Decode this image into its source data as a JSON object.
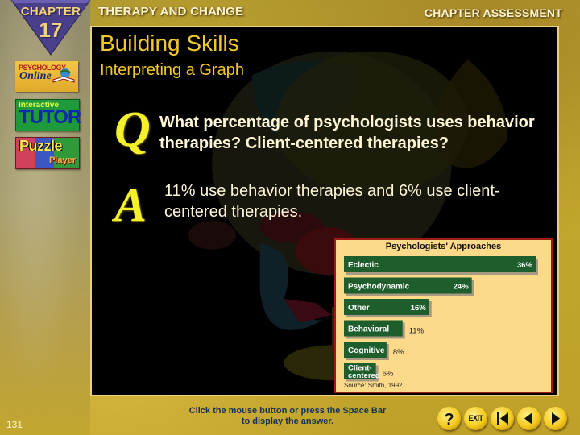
{
  "header": {
    "chapter_label": "CHAPTER",
    "chapter_number": "17",
    "title": "THERAPY AND CHANGE",
    "section": "CHAPTER ASSESSMENT"
  },
  "sidebar": {
    "items": [
      {
        "name": "psychology-online",
        "line1": "PSYCHOLOGY",
        "line2": "Online"
      },
      {
        "name": "interactive-tutor",
        "line1": "Interactive",
        "line2": "TUTOR"
      },
      {
        "name": "puzzle-player",
        "line1": "Puzzle",
        "line2": "Player"
      }
    ]
  },
  "slide": {
    "title": "Building Skills",
    "subtitle": "Interpreting a Graph",
    "q_letter": "Q",
    "a_letter": "A",
    "question": "What percentage of psychologists uses behavior therapies? Client-centered therapies?",
    "answer": "11% use behavior therapies and 6% use client-centered therapies."
  },
  "chart_data": {
    "type": "bar",
    "orientation": "horizontal",
    "title": "Psychologists' Approaches",
    "categories": [
      "Eclectic",
      "Psychodynamic",
      "Other",
      "Behavioral",
      "Cognitive",
      "Client-centered"
    ],
    "values": [
      36,
      24,
      16,
      11,
      8,
      6
    ],
    "value_labels": [
      "36%",
      "24%",
      "16%",
      "11%",
      "8%",
      "6%"
    ],
    "unit": "%",
    "source": "Source: Smith, 1992.",
    "xlabel": "",
    "ylabel": "",
    "xlim": [
      0,
      40
    ],
    "grid": false,
    "colors": {
      "bar": "#1d5e2c",
      "background": "#fdd98a",
      "border": "#9a1c14"
    }
  },
  "footer": {
    "page_number": "131",
    "instruction_line1": "Click the mouse button or press the Space Bar",
    "instruction_line2": "to display the answer.",
    "buttons": [
      {
        "name": "help",
        "label": "?"
      },
      {
        "name": "exit",
        "label": "EXIT"
      },
      {
        "name": "first",
        "label": "first"
      },
      {
        "name": "previous",
        "label": "previous"
      },
      {
        "name": "next",
        "label": "next"
      }
    ]
  },
  "colors": {
    "title_yellow": "#f2c92a",
    "qa_letter_yellow": "#f4f02a",
    "body_text": "#fff6d6",
    "instruction_text": "#12305a",
    "chapter_badge": "#4a3f8a"
  }
}
